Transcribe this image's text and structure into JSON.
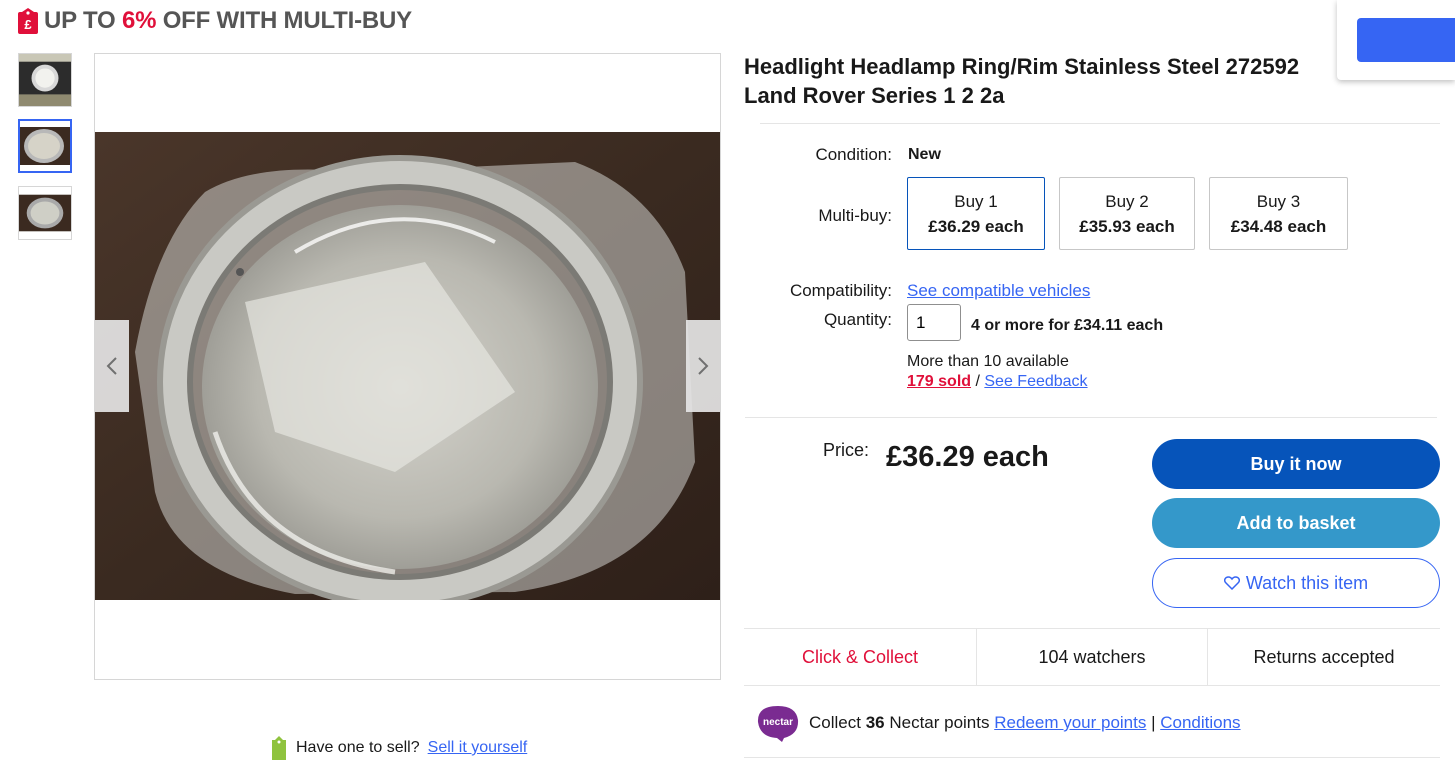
{
  "promo": {
    "prefix": "UP TO ",
    "pct": "6%",
    "suffix": " OFF WITH MULTI-BUY",
    "icon": "price-tag-icon"
  },
  "title": "Headlight Headlamp Ring/Rim Stainless Steel 272592 Land Rover Series 1 2 2a",
  "condition": {
    "label": "Condition:",
    "value": "New"
  },
  "multibuy": {
    "label": "Multi-buy:",
    "options": [
      {
        "qty": "Buy 1",
        "price": "£36.29 each"
      },
      {
        "qty": "Buy 2",
        "price": "£35.93 each"
      },
      {
        "qty": "Buy 3",
        "price": "£34.48 each"
      }
    ],
    "selected": 0
  },
  "compatibility": {
    "label": "Compatibility:",
    "link": "See compatible vehicles"
  },
  "quantity": {
    "label": "Quantity:",
    "value": "1",
    "offer": "4 or more for £34.11 each",
    "available": "More than 10 available",
    "sold": "179 sold",
    "sep": " / ",
    "feedback": "See Feedback"
  },
  "price": {
    "label": "Price:",
    "value": "£36.29 each"
  },
  "buttons": {
    "buy_now": "Buy it now",
    "add_basket": "Add to basket",
    "watch": "Watch this item"
  },
  "stats": {
    "collect": "Click & Collect",
    "watchers": "104 watchers",
    "returns": "Returns accepted"
  },
  "nectar": {
    "logo": "nectar",
    "pre": "Collect ",
    "points": "36",
    "post": " Nectar points ",
    "redeem": "Redeem your points",
    "sep": " | ",
    "conditions": "Conditions"
  },
  "sell": {
    "text": "Have one to sell?",
    "link": "Sell it yourself"
  },
  "colors": {
    "accent": "#3665f3",
    "buy": "#0654ba",
    "basket": "#3498ca",
    "alert": "#e0103a"
  }
}
